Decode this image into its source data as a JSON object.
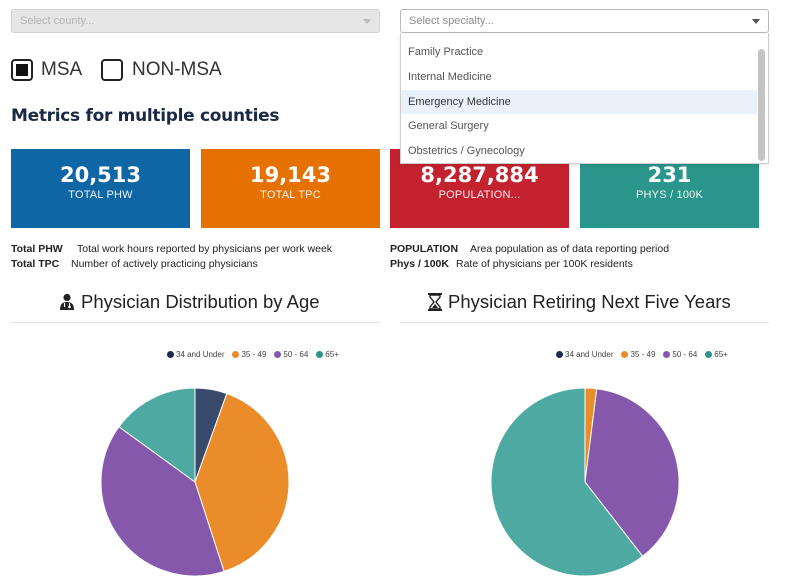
{
  "filters": {
    "county_placeholder": "Select county...",
    "specialty_placeholder": "Select specialty...",
    "specialty_options": [
      "Family Practice",
      "Internal Medicine",
      "Emergency Medicine",
      "General Surgery",
      "Obstetrics / Gynecology"
    ],
    "highlighted_option": "Emergency Medicine"
  },
  "area_type": {
    "msa_label": "MSA",
    "msa_checked": true,
    "non_msa_label": "NON-MSA",
    "non_msa_checked": false
  },
  "section_title": "Metrics for multiple counties",
  "tiles": [
    {
      "value": "20,513",
      "label": "TOTAL PHW",
      "color": "#0f66a4"
    },
    {
      "value": "19,143",
      "label": "TOTAL TPC",
      "color": "#e57200"
    },
    {
      "value": "8,287,884",
      "label": "POPULATION...",
      "color": "#c5222f"
    },
    {
      "value": "231",
      "label": "PHYS / 100K",
      "color": "#2a968b"
    }
  ],
  "definitions": [
    {
      "term": "Total PHW",
      "desc": "Total work hours reported by physicians per work week"
    },
    {
      "term": "Total TPC",
      "desc": "Number of actively practicing physicians"
    },
    {
      "term": "POPULATION",
      "desc": "Area population as of data reporting period"
    },
    {
      "term": "Phys / 100K",
      "desc": "Rate of physicians per 100K residents"
    }
  ],
  "charts": {
    "age_title": "Physician Distribution by Age",
    "age_icon": "doctor-icon",
    "retire_title": "Physician Retiring Next Five Years",
    "retire_icon": "hourglass-icon"
  },
  "chart_data": [
    {
      "type": "pie",
      "categories": [
        "34 and Under",
        "35 - 49",
        "50 - 64",
        "65+"
      ],
      "values": [
        5.5,
        39.5,
        40.0,
        15.0
      ],
      "colors": [
        "#3a4a6b",
        "#eb8c2a",
        "#8658ac",
        "#4ea9a2"
      ],
      "legend": "top-right"
    },
    {
      "type": "pie",
      "categories": [
        "34 and Under",
        "35 - 49",
        "50 - 64",
        "65+"
      ],
      "values": [
        0,
        2.0,
        37.5,
        60.5
      ],
      "colors": [
        "#3a4a6b",
        "#eb8c2a",
        "#8658ac",
        "#4ea9a2"
      ],
      "legend": "top-right"
    }
  ]
}
